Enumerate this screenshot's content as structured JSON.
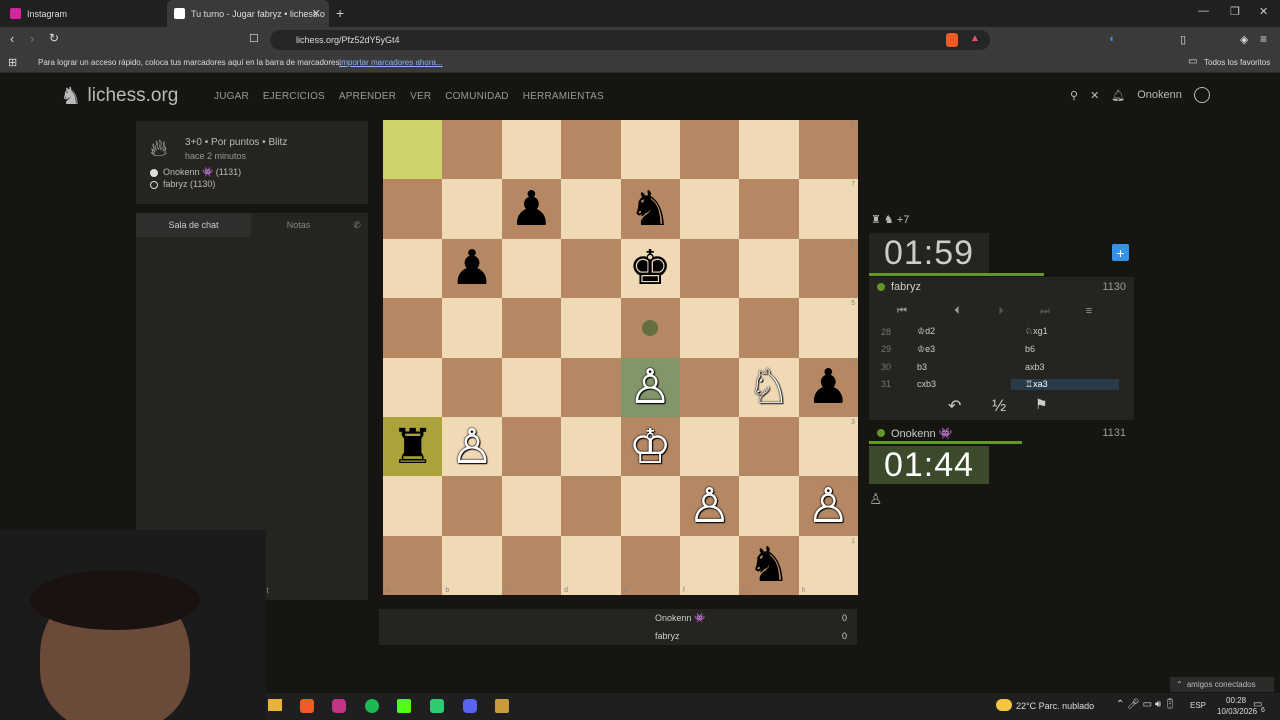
{
  "browser": {
    "tabs": [
      {
        "label": "Instagram"
      },
      {
        "label": "Tu turno - Jugar fabryz • lichess.o"
      }
    ],
    "url": "lichess.org/Pfz52dY5yGt4",
    "bookmarks_hint": "Para lograr un acceso rápido, coloca tus marcadores aquí en la barra de marcadores.",
    "bookmarks_import": "Importar marcadores ahora...",
    "all_favorites": "Todos los favoritos"
  },
  "site": {
    "logo": "lichess.org",
    "nav": [
      "JUGAR",
      "EJERCICIOS",
      "APRENDER",
      "VER",
      "COMUNIDAD",
      "HERRAMIENTAS"
    ],
    "username": "Onokenn"
  },
  "game": {
    "mode": "3+0 • Por puntos • Blitz",
    "ago": "hace 2 minutos",
    "white_player": "Onokenn 👾 (1131)",
    "black_player": "fabryz (1130)"
  },
  "chat": {
    "tab_chat": "Sala de chat",
    "tab_notes": "Notas",
    "partial_text": "nt"
  },
  "board": {
    "ranks": [
      "8",
      "7",
      "6",
      "5",
      "4",
      "3",
      "2",
      "1"
    ],
    "files": [
      "a",
      "b",
      "c",
      "d",
      "e",
      "f",
      "g",
      "h"
    ],
    "rows": [
      [
        "",
        "",
        "",
        "",
        "",
        "",
        "",
        ""
      ],
      [
        "",
        "",
        "♟",
        "",
        "♞",
        "",
        "",
        ""
      ],
      [
        "",
        "♟",
        "",
        "",
        "♚",
        "",
        "",
        ""
      ],
      [
        "",
        "",
        "",
        "",
        "",
        "",
        "",
        ""
      ],
      [
        "",
        "",
        "",
        "",
        "♙",
        "",
        "♘",
        "♟"
      ],
      [
        "♜",
        "♙",
        "",
        "",
        "♔",
        "",
        "",
        ""
      ],
      [
        "",
        "",
        "",
        "",
        "",
        "♙",
        "",
        "♙"
      ],
      [
        "",
        "",
        "",
        "",
        "",
        "",
        "♞",
        ""
      ]
    ]
  },
  "panel": {
    "captured": "♜ ♞ +7",
    "clock_top": "01:59",
    "clock_bottom": "01:44",
    "opponent_name": "fabryz",
    "opponent_rating": "1130",
    "self_name": "Onokenn 👾",
    "self_rating": "1131",
    "moves": [
      {
        "n": "28",
        "w": "♔d2",
        "b": "♘xg1"
      },
      {
        "n": "29",
        "w": "♔e3",
        "b": "b6"
      },
      {
        "n": "30",
        "w": "b3",
        "b": "axb3"
      },
      {
        "n": "31",
        "w": "cxb3",
        "b": "♖xa3"
      }
    ],
    "draw_label": "½",
    "bottom_pawn": "♙"
  },
  "score": {
    "p1": "Onokenn 👾",
    "p1_score": "0",
    "p2": "fabryz",
    "p2_score": "0"
  },
  "taskbar": {
    "weather": "22°C  Parc. nublado",
    "lang": "ESP",
    "time": "00:28",
    "date": "10/03/2026",
    "notif": "6",
    "friends": "amigos conectados"
  }
}
